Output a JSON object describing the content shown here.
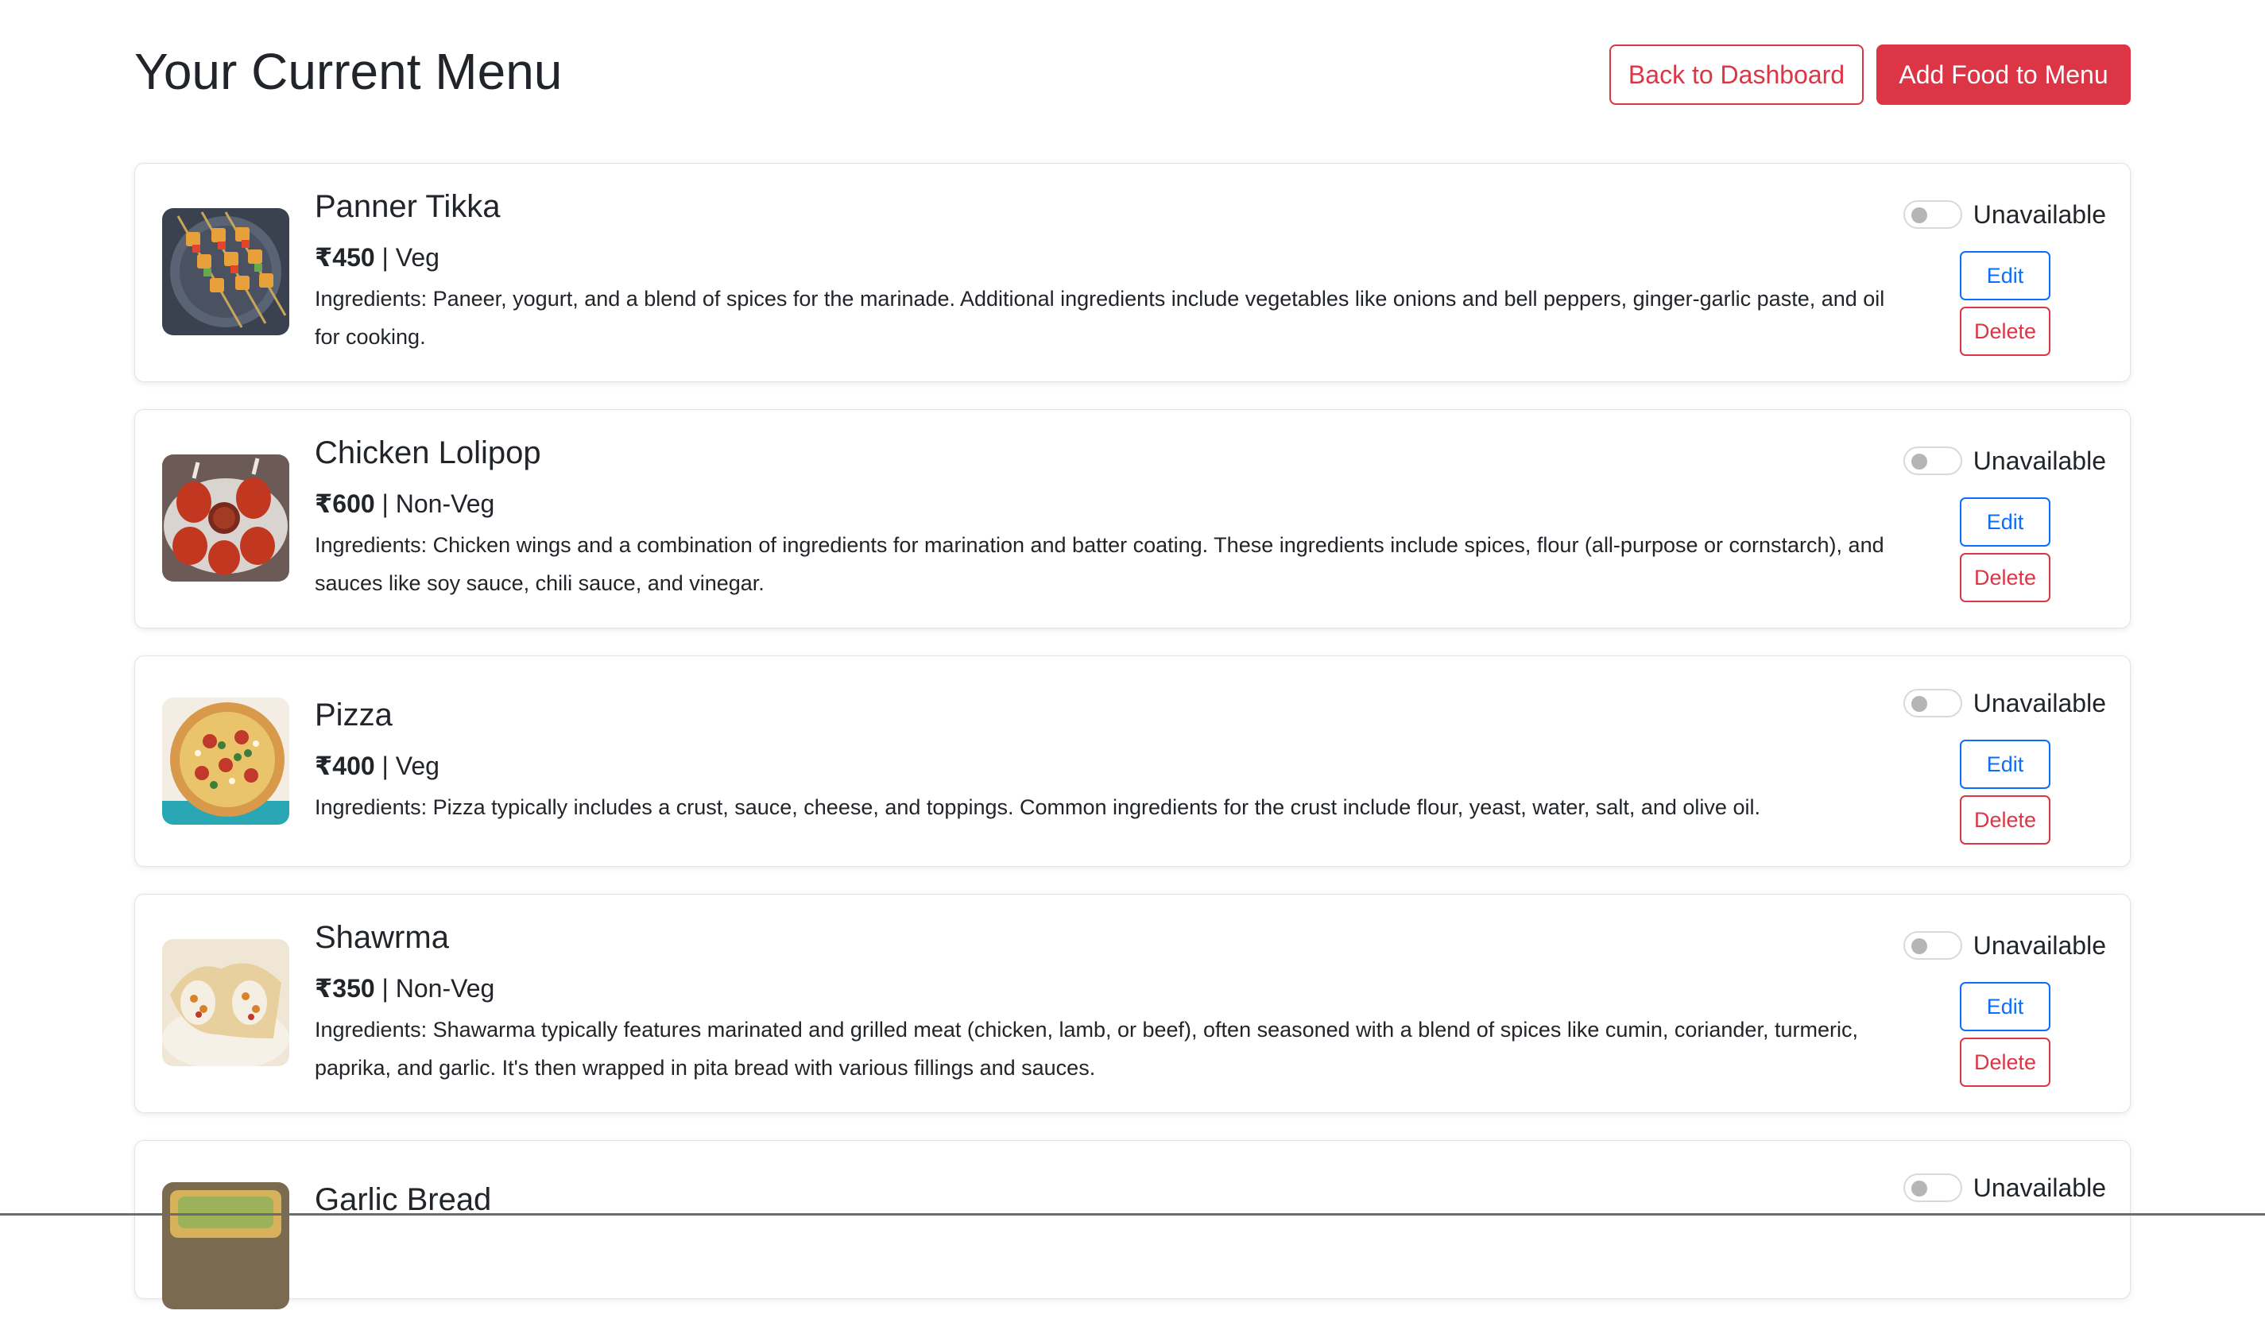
{
  "header": {
    "title": "Your Current Menu",
    "back_label": "Back to Dashboard",
    "add_label": "Add Food to Menu"
  },
  "menu": {
    "items": [
      {
        "name": "Panner Tikka",
        "price": "₹450",
        "separator": "|",
        "type": "Veg",
        "description": "Ingredients: Paneer, yogurt, and a blend of spices for the marinade. Additional ingredients include vegetables like onions and bell peppers, ginger-garlic paste, and oil for cooking.",
        "availability": "Unavailable",
        "available": false,
        "edit_label": "Edit",
        "delete_label": "Delete",
        "image_icon": "paneer-tikka-skewers"
      },
      {
        "name": "Chicken Lolipop",
        "price": "₹600",
        "separator": "|",
        "type": "Non-Veg",
        "description": "Ingredients: Chicken wings and a combination of ingredients for marination and batter coating. These ingredients include spices, flour (all-purpose or cornstarch), and sauces like soy sauce, chili sauce, and vinegar.",
        "availability": "Unavailable",
        "available": false,
        "edit_label": "Edit",
        "delete_label": "Delete",
        "image_icon": "chicken-lollipop-plate"
      },
      {
        "name": "Pizza",
        "price": "₹400",
        "separator": "|",
        "type": "Veg",
        "description": "Ingredients: Pizza typically includes a crust, sauce, cheese, and toppings. Common ingredients for the crust include flour, yeast, water, salt, and olive oil.",
        "availability": "Unavailable",
        "available": false,
        "edit_label": "Edit",
        "delete_label": "Delete",
        "image_icon": "pizza"
      },
      {
        "name": "Shawrma",
        "price": "₹350",
        "separator": "|",
        "type": "Non-Veg",
        "description": "Ingredients: Shawarma typically features marinated and grilled meat (chicken, lamb, or beef), often seasoned with a blend of spices like cumin, coriander, turmeric, paprika, and garlic. It's then wrapped in pita bread with various fillings and sauces.",
        "availability": "Unavailable",
        "available": false,
        "edit_label": "Edit",
        "delete_label": "Delete",
        "image_icon": "shawarma-wraps"
      },
      {
        "name": "Garlic Bread",
        "availability": "Unavailable",
        "available": false,
        "image_icon": "garlic-bread"
      }
    ]
  },
  "colors": {
    "danger": "#dc3545",
    "primary": "#0d6efd",
    "text": "#212529"
  }
}
